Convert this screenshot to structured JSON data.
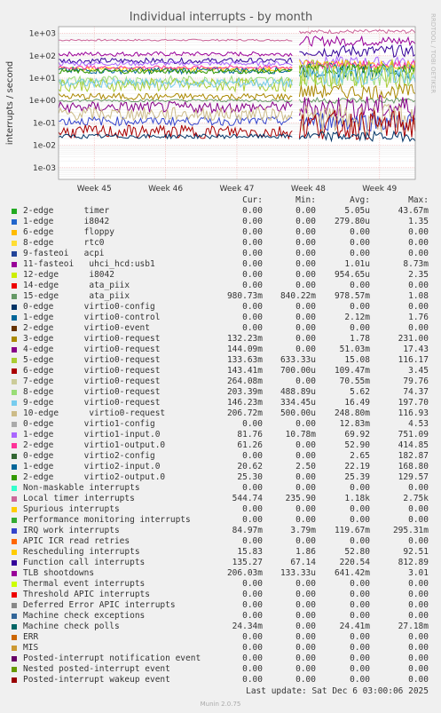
{
  "title": "Individual interrupts - by month",
  "side_label": "RRDTOOL / TOBI OETIKER",
  "ylabel": "interrupts / second",
  "header": {
    "cur": "Cur:",
    "min": "Min:",
    "avg": "Avg:",
    "max": "Max:"
  },
  "last_update": "Last update: Sat Dec  6 03:00:06 2025",
  "version": "Munin 2.0.75",
  "chart_data": {
    "type": "line",
    "title": "Individual interrupts - by month",
    "ylabel": "interrupts / second",
    "yscale": "log",
    "ylim": [
      0.0003,
      2000
    ],
    "yticks": [
      {
        "v": 1000,
        "label": "1e+03"
      },
      {
        "v": 100,
        "label": "1e+02"
      },
      {
        "v": 10,
        "label": "1e+01"
      },
      {
        "v": 1,
        "label": "1e+00"
      },
      {
        "v": 0.1,
        "label": "1e-01"
      },
      {
        "v": 0.01,
        "label": "1e-02"
      },
      {
        "v": 0.001,
        "label": "1e-03"
      }
    ],
    "xticks": [
      "Week 45",
      "Week 46",
      "Week 47",
      "Week 48",
      "Week 49"
    ],
    "xtick_pos": [
      0.1,
      0.3,
      0.5,
      0.7,
      0.9
    ],
    "break_at": 0.665,
    "grid": true,
    "series": [
      {
        "name": "Local timer interrupts",
        "color": "#cc6699",
        "before": 500,
        "after": 1200,
        "noise": 0.04
      },
      {
        "name": "TLB shootdowns",
        "color": "#990099",
        "before": 120,
        "after": 450,
        "noise": 0.1
      },
      {
        "name": "Function call interrupts",
        "color": "#330099",
        "before": 60,
        "after": 160,
        "noise": 0.12
      },
      {
        "name": "virtio1-input.0",
        "color": "#aa66ff",
        "before": 45,
        "after": 55,
        "noise": 0.1
      },
      {
        "name": "Rescheduling interrupts",
        "color": "#ffcc00",
        "before": 25,
        "after": 40,
        "noise": 0.1
      },
      {
        "name": "virtio2-input.0",
        "color": "#006699",
        "before": 22,
        "after": 22,
        "noise": 0.15
      },
      {
        "name": "virtio1-output.0",
        "color": "#ff3399",
        "before": 30,
        "after": 40,
        "noise": 0.08
      },
      {
        "name": "virtio2-output.0",
        "color": "#339900",
        "before": 20,
        "after": 25,
        "noise": 0.1
      },
      {
        "name": "8-edge virtio0-request",
        "color": "#99dd77",
        "before": 8,
        "after": 12,
        "noise": 0.2
      },
      {
        "name": "5-edge virtio0-request",
        "color": "#aacc33",
        "before": 5,
        "after": 15,
        "noise": 0.3
      },
      {
        "name": "9-edge virtio0-request",
        "color": "#77ccee",
        "before": 6,
        "after": 14,
        "noise": 0.2
      },
      {
        "name": "3-edge virtio0-request",
        "color": "#aa8800",
        "before": 1.5,
        "after": 2.5,
        "noise": 0.15
      },
      {
        "name": "15-edge ata_piix",
        "color": "#669966",
        "before": 1.0,
        "after": 1.0,
        "noise": 0.06
      },
      {
        "name": "4-edge virtio0-request",
        "color": "#880088",
        "before": 0.5,
        "after": 0.5,
        "noise": 0.25
      },
      {
        "name": "IRQ work interrupts",
        "color": "#3344cc",
        "before": 0.12,
        "after": 0.12,
        "noise": 0.2
      },
      {
        "name": "10-edge virtio0-request",
        "color": "#ccbb88",
        "before": 0.25,
        "after": 0.15,
        "noise": 0.3
      },
      {
        "name": "6-edge virtio0-request",
        "color": "#aa0000",
        "before": 0.04,
        "after": 0.08,
        "noise": 0.3
      },
      {
        "name": "0-edge virtio0-config",
        "color": "#003366",
        "before": 0.025,
        "after": 0.025,
        "noise": 0.1
      }
    ]
  },
  "legend": [
    {
      "name": "2-edge      timer",
      "color": "#22aa22",
      "cur": "0.00",
      "min": "0.00",
      "avg": "5.05u",
      "max": "43.67m"
    },
    {
      "name": "1-edge      i8042",
      "color": "#2266cc",
      "cur": "0.00",
      "min": "0.00",
      "avg": "279.80u",
      "max": "1.35"
    },
    {
      "name": "6-edge      floppy",
      "color": "#ffbb00",
      "cur": "0.00",
      "min": "0.00",
      "avg": "0.00",
      "max": "0.00"
    },
    {
      "name": "8-edge      rtc0",
      "color": "#ffdd33",
      "cur": "0.00",
      "min": "0.00",
      "avg": "0.00",
      "max": "0.00"
    },
    {
      "name": "9-fasteoi   acpi",
      "color": "#224499",
      "cur": "0.00",
      "min": "0.00",
      "avg": "0.00",
      "max": "0.00"
    },
    {
      "name": "11-fasteoi   uhci_hcd:usb1",
      "color": "#990099",
      "cur": "0.00",
      "min": "0.00",
      "avg": "1.01u",
      "max": "8.73m"
    },
    {
      "name": "12-edge      i8042",
      "color": "#ccee00",
      "cur": "0.00",
      "min": "0.00",
      "avg": "954.65u",
      "max": "2.35"
    },
    {
      "name": "14-edge      ata_piix",
      "color": "#ee0000",
      "cur": "0.00",
      "min": "0.00",
      "avg": "0.00",
      "max": "0.00"
    },
    {
      "name": "15-edge      ata_piix",
      "color": "#669966",
      "cur": "980.73m",
      "min": "840.22m",
      "avg": "978.57m",
      "max": "1.08"
    },
    {
      "name": "0-edge      virtio0-config",
      "color": "#003366",
      "cur": "0.00",
      "min": "0.00",
      "avg": "0.00",
      "max": "0.00"
    },
    {
      "name": "1-edge      virtio0-control",
      "color": "#006699",
      "cur": "0.00",
      "min": "0.00",
      "avg": "2.12m",
      "max": "1.76"
    },
    {
      "name": "2-edge      virtio0-event",
      "color": "#663300",
      "cur": "0.00",
      "min": "0.00",
      "avg": "0.00",
      "max": "0.00"
    },
    {
      "name": "3-edge      virtio0-request",
      "color": "#aa8800",
      "cur": "132.23m",
      "min": "0.00",
      "avg": "1.78",
      "max": "231.00"
    },
    {
      "name": "4-edge      virtio0-request",
      "color": "#880088",
      "cur": "144.09m",
      "min": "0.00",
      "avg": "51.03m",
      "max": "17.43"
    },
    {
      "name": "5-edge      virtio0-request",
      "color": "#aacc33",
      "cur": "133.63m",
      "min": "633.33u",
      "avg": "15.08",
      "max": "116.17"
    },
    {
      "name": "6-edge      virtio0-request",
      "color": "#aa0000",
      "cur": "143.41m",
      "min": "700.00u",
      "avg": "109.47m",
      "max": "3.45"
    },
    {
      "name": "7-edge      virtio0-request",
      "color": "#cccc99",
      "cur": "264.08m",
      "min": "0.00",
      "avg": "70.55m",
      "max": "79.76"
    },
    {
      "name": "8-edge      virtio0-request",
      "color": "#99dd77",
      "cur": "203.39m",
      "min": "488.89u",
      "avg": "5.62",
      "max": "74.37"
    },
    {
      "name": "9-edge      virtio0-request",
      "color": "#77ccee",
      "cur": "146.23m",
      "min": "334.45u",
      "avg": "16.49",
      "max": "197.70"
    },
    {
      "name": "10-edge      virtio0-request",
      "color": "#ccbb88",
      "cur": "206.72m",
      "min": "500.00u",
      "avg": "248.80m",
      "max": "116.93"
    },
    {
      "name": "0-edge      virtio1-config",
      "color": "#aaaaaa",
      "cur": "0.00",
      "min": "0.00",
      "avg": "12.83m",
      "max": "4.53"
    },
    {
      "name": "1-edge      virtio1-input.0",
      "color": "#aa66ff",
      "cur": "81.76",
      "min": "10.78m",
      "avg": "69.92",
      "max": "751.09"
    },
    {
      "name": "2-edge      virtio1-output.0",
      "color": "#ff3399",
      "cur": "61.26",
      "min": "0.00",
      "avg": "52.90",
      "max": "414.85"
    },
    {
      "name": "0-edge      virtio2-config",
      "color": "#336633",
      "cur": "0.00",
      "min": "0.00",
      "avg": "2.65",
      "max": "182.87"
    },
    {
      "name": "1-edge      virtio2-input.0",
      "color": "#006699",
      "cur": "20.62",
      "min": "2.50",
      "avg": "22.19",
      "max": "168.80"
    },
    {
      "name": "2-edge      virtio2-output.0",
      "color": "#339900",
      "cur": "25.30",
      "min": "0.00",
      "avg": "25.39",
      "max": "129.57"
    },
    {
      "name": "Non-maskable interrupts",
      "color": "#33ffcc",
      "cur": "0.00",
      "min": "0.00",
      "avg": "0.00",
      "max": "0.00"
    },
    {
      "name": "Local timer interrupts",
      "color": "#cc6699",
      "cur": "544.74",
      "min": "235.90",
      "avg": "1.18k",
      "max": "2.75k"
    },
    {
      "name": "Spurious interrupts",
      "color": "#ffcc00",
      "cur": "0.00",
      "min": "0.00",
      "avg": "0.00",
      "max": "0.00"
    },
    {
      "name": "Performance monitoring interrupts",
      "color": "#33aa33",
      "cur": "0.00",
      "min": "0.00",
      "avg": "0.00",
      "max": "0.00"
    },
    {
      "name": "IRQ work interrupts",
      "color": "#3344cc",
      "cur": "84.97m",
      "min": "3.79m",
      "avg": "119.67m",
      "max": "295.31m"
    },
    {
      "name": "APIC ICR read retries",
      "color": "#ff6600",
      "cur": "0.00",
      "min": "0.00",
      "avg": "0.00",
      "max": "0.00"
    },
    {
      "name": "Rescheduling interrupts",
      "color": "#ffcc00",
      "cur": "15.83",
      "min": "1.86",
      "avg": "52.80",
      "max": "92.51"
    },
    {
      "name": "Function call interrupts",
      "color": "#330099",
      "cur": "135.27",
      "min": "67.14",
      "avg": "220.54",
      "max": "812.89"
    },
    {
      "name": "TLB shootdowns",
      "color": "#990099",
      "cur": "206.03m",
      "min": "133.33u",
      "avg": "641.42m",
      "max": "3.01"
    },
    {
      "name": "Thermal event interrupts",
      "color": "#ccff00",
      "cur": "0.00",
      "min": "0.00",
      "avg": "0.00",
      "max": "0.00"
    },
    {
      "name": "Threshold APIC interrupts",
      "color": "#ee0000",
      "cur": "0.00",
      "min": "0.00",
      "avg": "0.00",
      "max": "0.00"
    },
    {
      "name": "Deferred Error APIC interrupts",
      "color": "#888888",
      "cur": "0.00",
      "min": "0.00",
      "avg": "0.00",
      "max": "0.00"
    },
    {
      "name": "Machine check exceptions",
      "color": "#336699",
      "cur": "0.00",
      "min": "0.00",
      "avg": "0.00",
      "max": "0.00"
    },
    {
      "name": "Machine check polls",
      "color": "#006666",
      "cur": "24.34m",
      "min": "0.00",
      "avg": "24.41m",
      "max": "27.18m"
    },
    {
      "name": "ERR",
      "color": "#cc6600",
      "cur": "0.00",
      "min": "0.00",
      "avg": "0.00",
      "max": "0.00"
    },
    {
      "name": "MIS",
      "color": "#cc9933",
      "cur": "0.00",
      "min": "0.00",
      "avg": "0.00",
      "max": "0.00"
    },
    {
      "name": "Posted-interrupt notification event",
      "color": "#660066",
      "cur": "0.00",
      "min": "0.00",
      "avg": "0.00",
      "max": "0.00"
    },
    {
      "name": "Nested posted-interrupt event",
      "color": "#669900",
      "cur": "0.00",
      "min": "0.00",
      "avg": "0.00",
      "max": "0.00"
    },
    {
      "name": "Posted-interrupt wakeup event",
      "color": "#990000",
      "cur": "0.00",
      "min": "0.00",
      "avg": "0.00",
      "max": "0.00"
    }
  ]
}
